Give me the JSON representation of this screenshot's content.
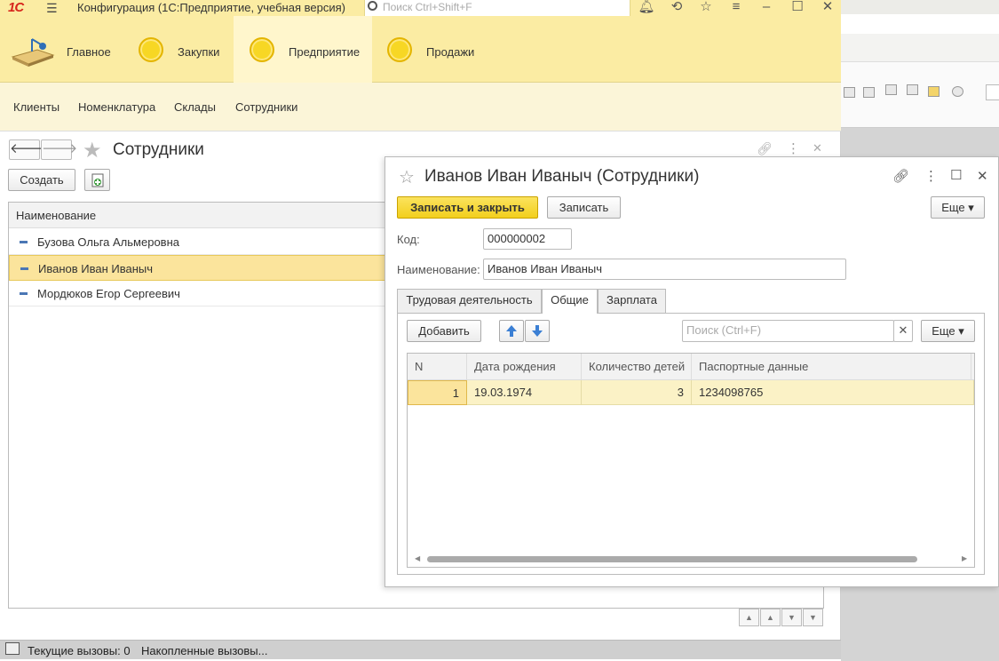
{
  "app": {
    "title": "Конфигурация  (1С:Предприятие, учебная версия)",
    "logo_text": "1С",
    "search_placeholder": "Поиск Ctrl+Shift+F"
  },
  "sections": [
    {
      "label": "Главное"
    },
    {
      "label": "Закупки"
    },
    {
      "label": "Предприятие"
    },
    {
      "label": "Продажи"
    }
  ],
  "subnav": [
    "Клиенты",
    "Номенклатура",
    "Склады",
    "Сотрудники"
  ],
  "list_form": {
    "title": "Сотрудники",
    "create_label": "Создать",
    "column_header": "Наименование",
    "rows": [
      {
        "name": "Бузова Ольга Альмеровна"
      },
      {
        "name": "Иванов Иван Иваныч",
        "selected": true
      },
      {
        "name": "Мордюков Егор Сергеевич"
      }
    ]
  },
  "item_form": {
    "title": "Иванов Иван Иваныч (Сотрудники)",
    "save_close_label": "Записать и закрыть",
    "save_label": "Записать",
    "more_label": "Еще",
    "code_label": "Код:",
    "code_value": "000000002",
    "name_label": "Наименование:",
    "name_value": "Иванов Иван Иваныч",
    "tabs": [
      "Трудовая деятельность",
      "Общие",
      "Зарплата"
    ],
    "active_tab": "Общие",
    "add_label": "Добавить",
    "search_placeholder": "Поиск (Ctrl+F)",
    "table_more_label": "Еще",
    "table": {
      "columns": [
        "N",
        "Дата рождения",
        "Количество детей",
        "Паспортные данные"
      ],
      "rows": [
        {
          "n": "1",
          "birth_date": "19.03.1974",
          "children": "3",
          "passport": "1234098765"
        }
      ]
    }
  },
  "status": {
    "current_calls": "Текущие вызовы: 0",
    "accumulated_calls": "Накопленные вызовы..."
  },
  "colors": {
    "section_bg": "#fbeca3",
    "accent_yellow": "#f2cf1d",
    "selected_row": "#fbe49c"
  }
}
